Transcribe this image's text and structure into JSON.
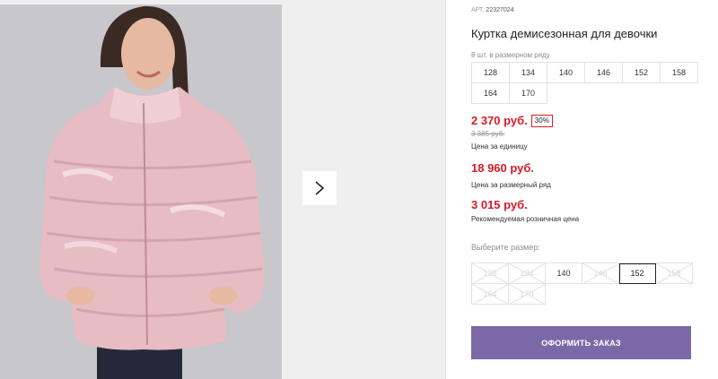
{
  "product": {
    "sku_label": "АРТ.",
    "sku_value": "22327024",
    "title": "Куртка демисезонная для девочки"
  },
  "size_row": {
    "label": "8 шт. в размерном ряду",
    "sizes": [
      "128",
      "134",
      "140",
      "146",
      "152",
      "158",
      "164",
      "170"
    ]
  },
  "prices": {
    "unit_price": "2 370 руб.",
    "discount": "30%",
    "old_price": "3 385 руб.",
    "unit_caption": "Цена за единицу",
    "row_price": "18 960 руб.",
    "row_caption": "Цена за размерный ряд",
    "retail_price": "3 015 руб.",
    "retail_caption": "Рекомендуемая розничная цена"
  },
  "choose_size": {
    "label": "Выберите размер:",
    "options": [
      "128",
      "134",
      "140",
      "146",
      "152",
      "158",
      "164",
      "170"
    ],
    "selected": "152"
  },
  "order_button": "ОФОРМИТЬ ЗАКАЗ",
  "colors": {
    "price_red": "#d71b26",
    "accent_button": "#7a68a8"
  }
}
